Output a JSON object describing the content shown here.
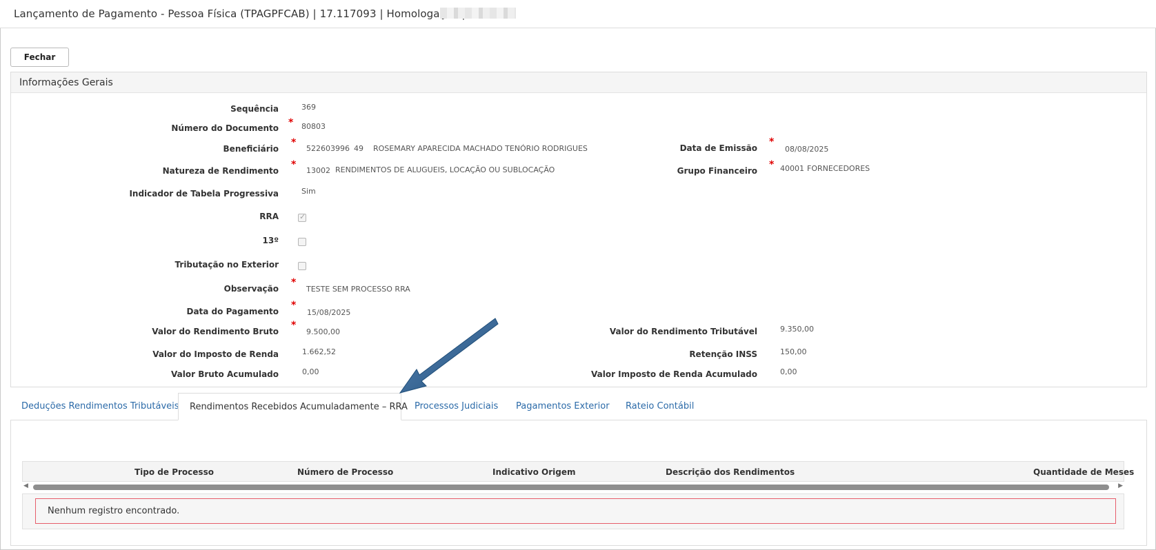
{
  "window": {
    "title": "Lançamento de Pagamento - Pessoa Física (TPAGPFCAB) | 17.117093 | Homologação |"
  },
  "toolbar": {
    "fechar_label": "Fechar"
  },
  "panel": {
    "title": "Informações Gerais",
    "sequencia": {
      "label": "Sequência",
      "value": "369"
    },
    "numero_documento": {
      "label": "Número do Documento",
      "value": "80803"
    },
    "beneficiario": {
      "label": "Beneficiário",
      "code": "522603996",
      "seq": "49",
      "name": "ROSEMARY APARECIDA MACHADO TENÓRIO RODRIGUES"
    },
    "data_emissao": {
      "label": "Data de Emissão",
      "value": "08/08/2025"
    },
    "natureza_rendimento": {
      "label": "Natureza de Rendimento",
      "code": "13002",
      "desc": "RENDIMENTOS DE ALUGUEIS, LOCAÇÃO OU SUBLOCAÇÃO"
    },
    "grupo_financeiro": {
      "label": "Grupo Financeiro",
      "code": "40001",
      "desc": "FORNECEDORES"
    },
    "indicador_tabela": {
      "label": "Indicador de Tabela Progressiva",
      "value": "Sim"
    },
    "rra": {
      "label": "RRA",
      "checked": true
    },
    "decimo_terceiro": {
      "label": "13º",
      "checked": false
    },
    "tributacao_exterior": {
      "label": "Tributação no Exterior",
      "checked": false
    },
    "observacao": {
      "label": "Observação",
      "value": "TESTE SEM PROCESSO RRA"
    },
    "data_pagamento": {
      "label": "Data do Pagamento",
      "value": "15/08/2025"
    },
    "valor_rendimento_bruto": {
      "label": "Valor do Rendimento Bruto",
      "value": "9.500,00"
    },
    "valor_rendimento_tributavel": {
      "label": "Valor do Rendimento Tributável",
      "value": "9.350,00"
    },
    "valor_imposto_renda": {
      "label": "Valor do Imposto de Renda",
      "value": "1.662,52"
    },
    "retencao_inss": {
      "label": "Retenção INSS",
      "value": "150,00"
    },
    "valor_bruto_acumulado": {
      "label": "Valor Bruto Acumulado",
      "value": "0,00"
    },
    "valor_imposto_acumulado": {
      "label": "Valor Imposto de Renda Acumulado",
      "value": "0,00"
    }
  },
  "tabs": [
    {
      "label": "Deduções Rendimentos Tributáveis",
      "active": false
    },
    {
      "label": "Rendimentos Recebidos Acumuladamente – RRA",
      "active": true
    },
    {
      "label": "Processos Judiciais",
      "active": false
    },
    {
      "label": "Pagamentos Exterior",
      "active": false
    },
    {
      "label": "Rateio Contábil",
      "active": false
    }
  ],
  "grid": {
    "columns": [
      "Tipo de Processo",
      "Número de Processo",
      "Indicativo Origem",
      "Descrição dos Rendimentos",
      "Quantidade de Meses"
    ],
    "empty_message": "Nenhum registro encontrado."
  },
  "colors": {
    "accent_link": "#2b6aa8",
    "required": "#e00000",
    "annotation_arrow": "#1f4e79",
    "empty_border": "#e65c6a"
  }
}
